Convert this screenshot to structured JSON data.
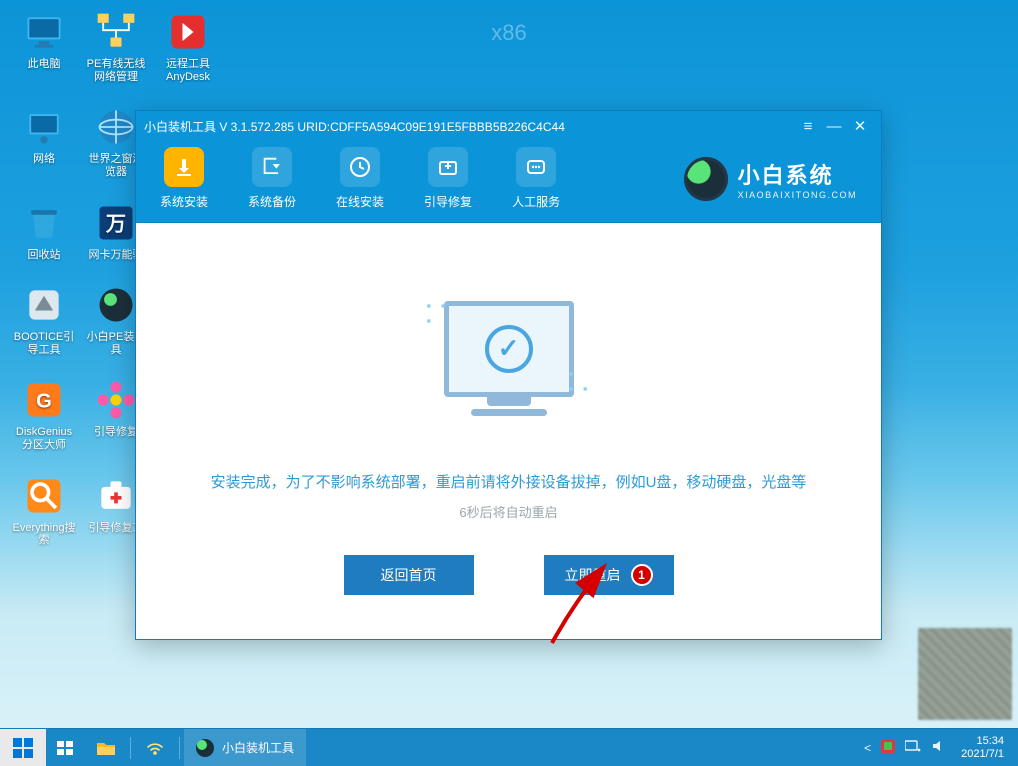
{
  "watermark": "x86",
  "desktop_icons": [
    [
      {
        "name": "此电脑",
        "icon": "pc"
      },
      {
        "name": "PE有线无线网络管理",
        "icon": "net"
      },
      {
        "name": "远程工具AnyDesk",
        "icon": "anydesk"
      }
    ],
    [
      {
        "name": "网络",
        "icon": "network"
      },
      {
        "name": "世界之窗浏览器",
        "icon": "browser"
      }
    ],
    [
      {
        "name": "回收站",
        "icon": "bin"
      },
      {
        "name": "网卡万能驱",
        "icon": "wan"
      }
    ],
    [
      {
        "name": "BOOTICE引导工具",
        "icon": "bootice"
      },
      {
        "name": "小白PE装机具",
        "icon": "xiaobai"
      }
    ],
    [
      {
        "name": "DiskGenius分区大师",
        "icon": "dg"
      },
      {
        "name": "引导修复",
        "icon": "flower"
      }
    ],
    [
      {
        "name": "Everything搜索",
        "icon": "search"
      },
      {
        "name": "引导修复工",
        "icon": "medkit"
      }
    ]
  ],
  "window": {
    "title": "小白装机工具 V 3.1.572.285 URID:CDFF5A594C09E191E5FBBB5B226C4C44",
    "tabs": [
      {
        "key": "install",
        "label": "系统安装",
        "active": true
      },
      {
        "key": "backup",
        "label": "系统备份",
        "active": false
      },
      {
        "key": "online",
        "label": "在线安装",
        "active": false
      },
      {
        "key": "bootfix",
        "label": "引导修复",
        "active": false
      },
      {
        "key": "service",
        "label": "人工服务",
        "active": false
      }
    ],
    "brand_name": "小白系统",
    "brand_url": "XIAOBAIXITONG.COM",
    "message": "安装完成，为了不影响系统部署，重启前请将外接设备拔掉，例如U盘，移动硬盘，光盘等",
    "countdown": "6秒后将自动重启",
    "btn_back": "返回首页",
    "btn_restart": "立即重启",
    "marker": "1"
  },
  "taskbar": {
    "app_label": "小白装机工具",
    "time": "15:34",
    "date": "2021/7/1"
  }
}
